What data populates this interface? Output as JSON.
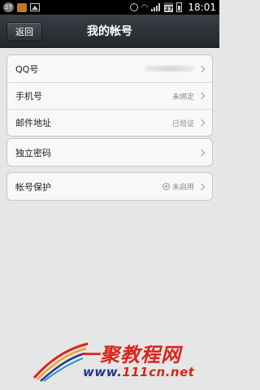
{
  "status_bar": {
    "badge": "27",
    "date": "27",
    "time": "18:01"
  },
  "header": {
    "back_label": "返回",
    "title": "我的帐号"
  },
  "groups": [
    {
      "rows": [
        {
          "label": "QQ号",
          "value": ""
        },
        {
          "label": "手机号",
          "value": "未绑定"
        },
        {
          "label": "邮件地址",
          "value": "已验证"
        }
      ]
    },
    {
      "rows": [
        {
          "label": "独立密码",
          "value": ""
        }
      ]
    },
    {
      "rows": [
        {
          "label": "帐号保护",
          "value": "未启用"
        }
      ]
    }
  ],
  "watermark": {
    "title": "一聚教程网",
    "url_prefix": "www.",
    "url_main": "111cn.net"
  },
  "colors": {
    "background": "#e6e6e6",
    "titlebar": "#2b2f34",
    "watermark_red": "#d8261a",
    "watermark_blue": "#1b3a8c"
  }
}
